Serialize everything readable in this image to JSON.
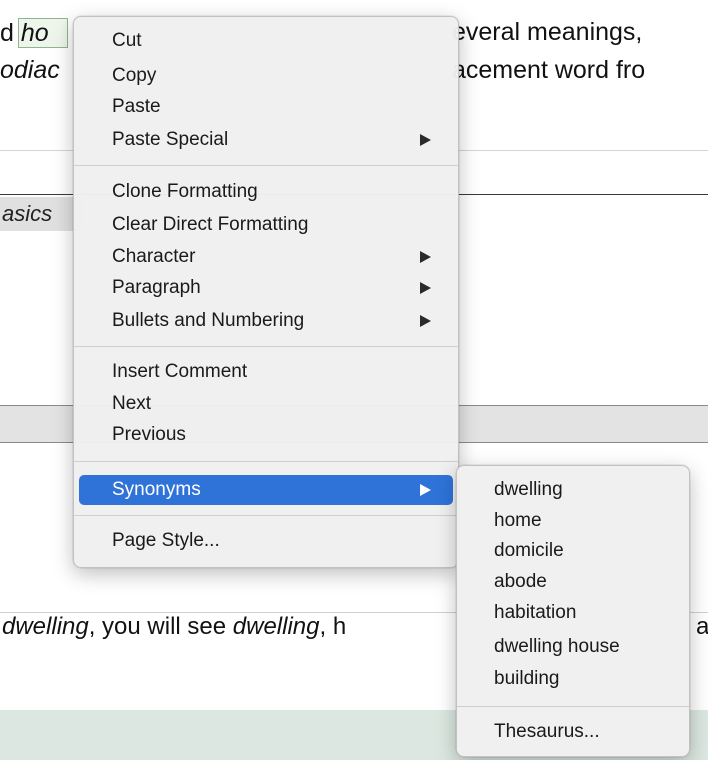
{
  "document": {
    "line1_prefix": "d",
    "line1_word": "ho",
    "line1_right": "everal meanings,",
    "line2_left": "odiac",
    "line2_right": "acement word fro",
    "heading_fragment": "asics",
    "line3_word1": "dwelling",
    "line3_middle": ", you will see ",
    "line3_word2": "dwelling",
    "line3_tail": ", h",
    "line3_right": "ab"
  },
  "context_menu": {
    "items": [
      {
        "label": "Cut"
      },
      {
        "label": "Copy"
      },
      {
        "label": "Paste"
      },
      {
        "label": "Paste Special",
        "submenu": true
      },
      {
        "label": "Clone Formatting"
      },
      {
        "label": "Clear Direct Formatting"
      },
      {
        "label": "Character",
        "submenu": true
      },
      {
        "label": "Paragraph",
        "submenu": true
      },
      {
        "label": "Bullets and Numbering",
        "submenu": true
      },
      {
        "label": "Insert Comment"
      },
      {
        "label": "Next"
      },
      {
        "label": "Previous"
      },
      {
        "label": "Synonyms",
        "submenu": true,
        "highlighted": true
      },
      {
        "label": "Page Style..."
      }
    ],
    "highlight_color": "#2f73d9"
  },
  "synonyms_menu": {
    "items": [
      {
        "label": "dwelling"
      },
      {
        "label": "home"
      },
      {
        "label": "domicile"
      },
      {
        "label": "abode"
      },
      {
        "label": "habitation"
      },
      {
        "label": "dwelling house"
      },
      {
        "label": "building"
      },
      {
        "label": "Thesaurus..."
      }
    ]
  }
}
